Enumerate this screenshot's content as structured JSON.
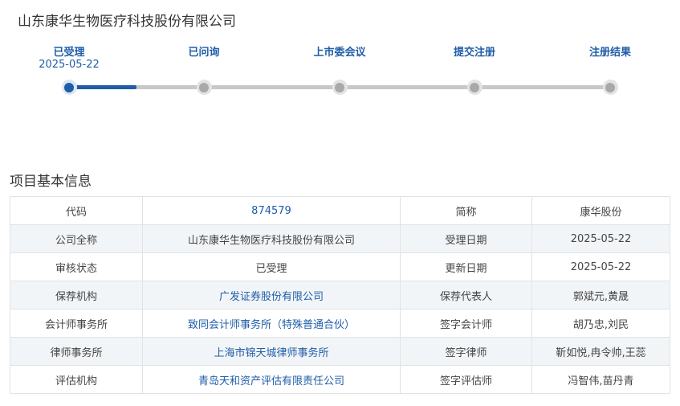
{
  "company_title": "山东康华生物医疗科技股份有限公司",
  "colors": {
    "accent": "#1f5da8",
    "inactive_node": "#a9a9a9",
    "track": "#c8c8c8",
    "row_alt": "#f2f5f8"
  },
  "progress": {
    "completed_fraction": 0.125,
    "steps": [
      {
        "label": "已受理",
        "date": "2025-05-22",
        "active": true
      },
      {
        "label": "已问询",
        "date": "",
        "active": false
      },
      {
        "label": "上市委会议",
        "date": "",
        "active": false
      },
      {
        "label": "提交注册",
        "date": "",
        "active": false
      },
      {
        "label": "注册结果",
        "date": "",
        "active": false
      }
    ]
  },
  "section_title": "项目基本信息",
  "info_rows": [
    {
      "k1": "代码",
      "v1": "874579",
      "k2": "简称",
      "v2": "康华股份",
      "v1_link": true
    },
    {
      "k1": "公司全称",
      "v1": "山东康华生物医疗科技股份有限公司",
      "k2": "受理日期",
      "v2": "2025-05-22",
      "v1_link": false
    },
    {
      "k1": "审核状态",
      "v1": "已受理",
      "k2": "更新日期",
      "v2": "2025-05-22",
      "v1_link": false
    },
    {
      "k1": "保荐机构",
      "v1": "广发证券股份有限公司",
      "k2": "保荐代表人",
      "v2": "郭斌元,黄晟",
      "v1_link": true
    },
    {
      "k1": "会计师事务所",
      "v1": "致同会计师事务所（特殊普通合伙）",
      "k2": "签字会计师",
      "v2": "胡乃忠,刘民",
      "v1_link": true
    },
    {
      "k1": "律师事务所",
      "v1": "上海市锦天城律师事务所",
      "k2": "签字律师",
      "v2": "靳如悦,冉令帅,王蕊",
      "v1_link": true
    },
    {
      "k1": "评估机构",
      "v1": "青岛天和资产评估有限责任公司",
      "k2": "签字评估师",
      "v2": "冯智伟,苗丹青",
      "v1_link": true
    }
  ]
}
